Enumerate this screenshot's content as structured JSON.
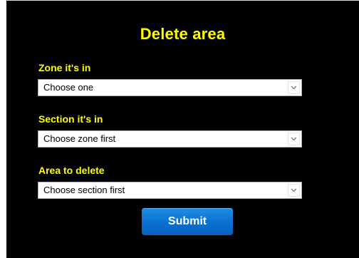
{
  "form": {
    "title": "Delete area",
    "fields": [
      {
        "label": "Zone it's in",
        "selected": "Choose one"
      },
      {
        "label": "Section it's in",
        "selected": "Choose zone first"
      },
      {
        "label": "Area to delete",
        "selected": "Choose section first"
      }
    ],
    "submit_label": "Submit"
  },
  "colors": {
    "background": "#000000",
    "label_text": "#ffff00",
    "button": "#0a70cf"
  },
  "icons": {
    "dropdown_arrow": "chevron-down-icon"
  }
}
